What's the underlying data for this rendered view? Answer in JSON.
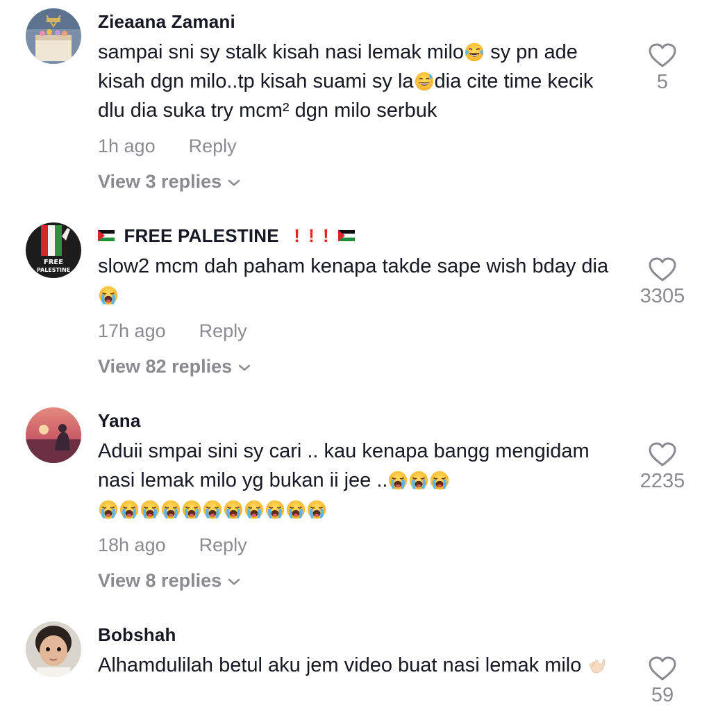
{
  "comments": [
    {
      "username": "Zieaana Zamani",
      "text_parts": [
        "sampai sni sy stalk kisah nasi lemak milo",
        " sy pn ade kisah dgn milo..tp kisah suami sy la",
        "dia cite time kecik dlu dia suka try mcm² dgn milo serbuk"
      ],
      "time": "1h ago",
      "reply_label": "Reply",
      "view_replies": "View 3 replies",
      "likes": "5",
      "emojis": [
        "joy-emoji",
        "sweat-smile-emoji"
      ]
    },
    {
      "username": "FREE PALESTINE",
      "username_decorations": [
        "palestine-flag",
        "!",
        "!",
        "!",
        "palestine-flag"
      ],
      "text_parts": [
        "slow2 mcm dah paham kenapa takde sape wish bday dia "
      ],
      "time": "17h ago",
      "reply_label": "Reply",
      "view_replies": "View 82 replies",
      "likes": "3305",
      "emojis": [
        "crying-emoji"
      ]
    },
    {
      "username": "Yana",
      "text_parts": [
        "Aduii smpai sini sy cari .. kau kenapa bangg mengidam nasi lemak milo yg bukan ii jee .."
      ],
      "time": "18h ago",
      "reply_label": "Reply",
      "view_replies": "View 8 replies",
      "likes": "2235",
      "emojis": [
        "crying-emoji x14"
      ]
    },
    {
      "username": "Bobshah",
      "text_parts": [
        "Alhamdulilah betul aku jem video buat nasi lemak milo "
      ],
      "likes": "59",
      "emojis": [
        "call-me-hand-emoji"
      ]
    }
  ],
  "colors": {
    "primary_text": "#161823",
    "secondary_text": "#8a8b91",
    "exclamation": "#e0261b"
  }
}
